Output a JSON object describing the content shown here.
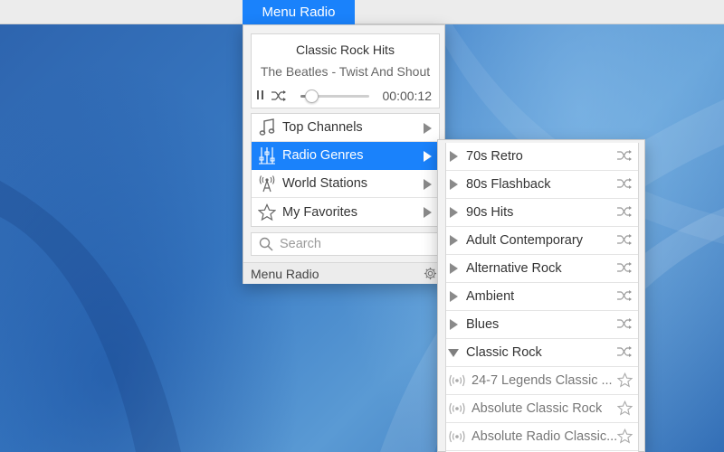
{
  "menubar": {
    "app_label": "Menu Radio"
  },
  "player": {
    "station": "Classic Rock Hits",
    "track": "The Beatles - Twist And Shout",
    "time": "00:00:12",
    "progress": 0.12
  },
  "menu": {
    "items": [
      {
        "label": "Top Channels",
        "icon": "music-note-icon"
      },
      {
        "label": "Radio Genres",
        "icon": "equalizer-icon",
        "active": true
      },
      {
        "label": "World Stations",
        "icon": "antenna-icon"
      },
      {
        "label": "My Favorites",
        "icon": "star-icon"
      }
    ],
    "search_placeholder": "Search",
    "footer_label": "Menu Radio"
  },
  "submenu": {
    "genres": [
      "70s Retro",
      "80s Flashback",
      "90s Hits",
      "Adult Contemporary",
      "Alternative Rock",
      "Ambient",
      "Blues",
      "Classic Rock"
    ],
    "stations": [
      "24-7 Legends Classic ...",
      "Absolute Classic Rock",
      "Absolute Radio Classic..."
    ]
  },
  "colors": {
    "accent": "#1a82fb",
    "menubar": "#ececec",
    "desktop": "#2f6db5"
  }
}
